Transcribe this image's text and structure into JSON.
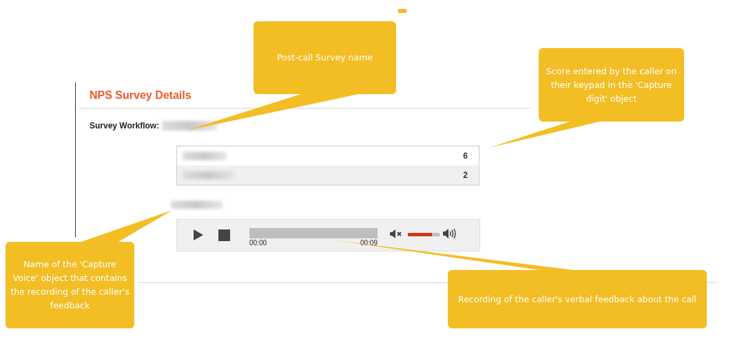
{
  "section": {
    "title": "NPS Survey Details",
    "workflow_label": "Survey Workflow:"
  },
  "scores": [
    {
      "value": "6"
    },
    {
      "value": "2"
    }
  ],
  "player": {
    "time_start": "00:00",
    "time_end": "00:09",
    "volume": {
      "level": 0.75
    }
  },
  "callouts": [
    {
      "text": "Post-call Survey name"
    },
    {
      "text": "Score entered by the caller on their keypad in the 'Capture digit' object"
    },
    {
      "text": "Name of the 'Capture Voice' object that contains the recording of the caller's feedback"
    },
    {
      "text": "Recording of the caller's verbal feedback about the call"
    }
  ]
}
